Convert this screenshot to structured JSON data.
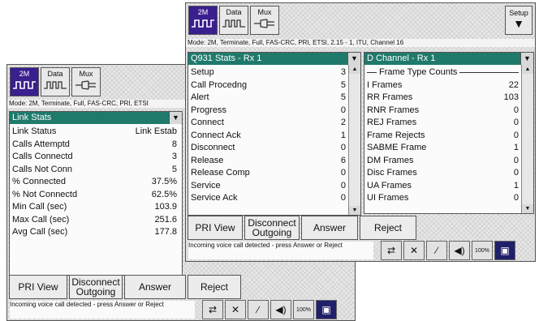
{
  "left_window": {
    "modes": [
      {
        "label": "2M",
        "active": true
      },
      {
        "label": "Data",
        "active": false
      },
      {
        "label": "Mux",
        "active": false
      }
    ],
    "mode_line": "Mode: 2M, Terminate, Full, FAS-CRC, PRI, ETSI",
    "stats_panel": {
      "title": "Link Stats",
      "rows": [
        {
          "label": "Link Status",
          "value": "Link Estab"
        },
        {
          "label": "Calls Attemptd",
          "value": "8"
        },
        {
          "label": "Calls Connectd",
          "value": "3"
        },
        {
          "label": "Calls Not Conn",
          "value": "5"
        },
        {
          "label": "% Connected",
          "value": "37.5%"
        },
        {
          "label": "% Not Connectd",
          "value": "62.5%"
        },
        {
          "label": "Min Call (sec)",
          "value": "103.9"
        },
        {
          "label": "Max Call (sec)",
          "value": "251.6"
        },
        {
          "label": "Avg Call (sec)",
          "value": "177.8"
        }
      ]
    },
    "buttons": {
      "pri_view": "PRI View",
      "disconnect": "Disconnect Outgoing",
      "answer": "Answer",
      "reject": "Reject"
    },
    "status": "Incoming voice call detected - press Answer or Reject"
  },
  "right_window": {
    "modes": [
      {
        "label": "2M",
        "active": true
      },
      {
        "label": "Data",
        "active": false
      },
      {
        "label": "Mux",
        "active": false
      }
    ],
    "setup_label": "Setup",
    "mode_line": "Mode: 2M, Terminate, Full, FAS-CRC, PRI, ETSI, 2.15 - 1, ITU, Channel 16",
    "q931_panel": {
      "title": "Q931 Stats - Rx 1",
      "rows": [
        {
          "label": "Setup",
          "value": "3"
        },
        {
          "label": "Call Procedng",
          "value": "5"
        },
        {
          "label": "Alert",
          "value": "5"
        },
        {
          "label": "Progress",
          "value": "0"
        },
        {
          "label": "Connect",
          "value": "2"
        },
        {
          "label": "Connect Ack",
          "value": "1"
        },
        {
          "label": "Disconnect",
          "value": "0"
        },
        {
          "label": "Release",
          "value": "6"
        },
        {
          "label": "Release Comp",
          "value": "0"
        },
        {
          "label": "Service",
          "value": "0"
        },
        {
          "label": "Service Ack",
          "value": "0"
        }
      ]
    },
    "dchannel_panel": {
      "title": "D Channel - Rx 1",
      "section": "Frame Type Counts",
      "rows": [
        {
          "label": "I Frames",
          "value": "22"
        },
        {
          "label": "RR Frames",
          "value": "103"
        },
        {
          "label": "RNR Frames",
          "value": "0"
        },
        {
          "label": "REJ Frames",
          "value": "0"
        },
        {
          "label": "Frame Rejects",
          "value": "0"
        },
        {
          "label": "SABME Frame",
          "value": "1"
        },
        {
          "label": "DM Frames",
          "value": "0"
        },
        {
          "label": "Disc Frames",
          "value": "0"
        },
        {
          "label": "UA Frames",
          "value": "1"
        },
        {
          "label": "UI Frames",
          "value": "0"
        }
      ]
    },
    "buttons": {
      "pri_view": "PRI View",
      "disconnect": "Disconnect Outgoing",
      "answer": "Answer",
      "reject": "Reject"
    },
    "status": "Incoming voice call detected - press Answer or Reject"
  },
  "toolbar_icons": [
    "swap-arrows-icon",
    "tools-icon",
    "probe-icon",
    "speaker-icon",
    "battery-100-icon",
    "screen-icon"
  ],
  "battery_label": "100%",
  "colors": {
    "accent_header": "#1f7a6c",
    "active_mode": "#3a1f8f"
  }
}
